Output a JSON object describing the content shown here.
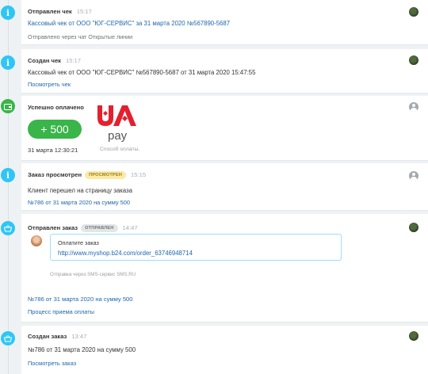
{
  "events": {
    "check_sent": {
      "title": "Отправлен чек",
      "time": "15:17",
      "link": "Кассовый чек от ООО \"ЮГ-СЕРВИС\" за 31 марта 2020 №567890-5687",
      "note": "Отправлено через чат Открытые линии"
    },
    "check_created": {
      "title": "Создан чек",
      "time": "15:17",
      "text": "Кассовый чек от ООО \"ЮГ-СЕРВИС\" №567890-5687 от 31 марта 2020 15:47:55",
      "link": "Посмотреть чек"
    },
    "paid": {
      "title": "Успешно оплачено",
      "amount": "+ 500",
      "date": "31 марта 12:30:21",
      "logo_text": "UA pay",
      "method_label": "Способ оплаты."
    },
    "order_viewed": {
      "title": "Заказ просмотрен",
      "badge": "ПРОСМОТРЕН",
      "time": "15:15",
      "text": "Клиент перешел на страницу заказа",
      "link": "№786 от 31 марта 2020 на сумму 500"
    },
    "order_sent": {
      "title": "Отправлен заказ",
      "badge": "ОТПРАВЛЕН",
      "time": "14:47",
      "sms_title": "Оплатите заказ",
      "sms_link": "http://www.myshop.b24.com/order_63746948714",
      "sms_via": "Отправка через SMS-сервис SMS.RU",
      "order_link": "№786 от 31 марта 2020 на сумму 500",
      "process_link": "Процесс приема оплаты"
    },
    "order_created": {
      "title": "Создан заказ",
      "time": "13:47",
      "text": "№786 от 31 марта 2020 на сумму 500",
      "link": "Посмотреть заказ"
    }
  },
  "colors": {
    "info": "#2fc6f6",
    "paid": "#39b54a",
    "link": "#2067b0",
    "ua_red": "#e4202e"
  },
  "icons": [
    "info-icon",
    "wallet-icon",
    "basket-icon",
    "user-avatar"
  ]
}
